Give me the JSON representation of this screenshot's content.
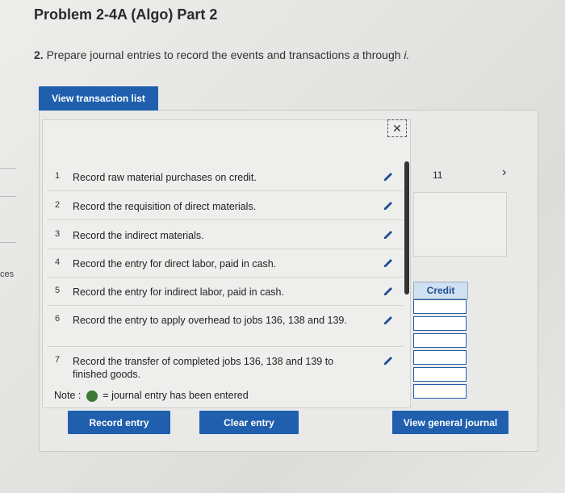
{
  "header": {
    "title": "Problem 2-4A (Algo) Part 2",
    "prompt_num": "2.",
    "prompt_text": "Prepare journal entries to record the events and transactions",
    "prompt_italic": "a",
    "prompt_through": "through",
    "prompt_end": "i."
  },
  "view_list_label": "View transaction list",
  "left_cut_text": "ces",
  "close_glyph": "✕",
  "transactions": [
    {
      "num": "1",
      "text": "Record raw material purchases on credit."
    },
    {
      "num": "2",
      "text": "Record the requisition of direct materials."
    },
    {
      "num": "3",
      "text": "Record the indirect materials."
    },
    {
      "num": "4",
      "text": "Record the entry for direct labor, paid in cash."
    },
    {
      "num": "5",
      "text": "Record the entry for indirect labor, paid in cash."
    },
    {
      "num": "6",
      "text": "Record the entry to apply overhead to jobs 136, 138 and 139."
    },
    {
      "num": "7",
      "text": "Record the transfer of completed jobs 136, 138 and 139 to finished goods."
    }
  ],
  "note": {
    "label": "Note :",
    "text": "= journal entry has been entered"
  },
  "right": {
    "page_number": "11",
    "chevron": "›",
    "credit_header": "Credit"
  },
  "buttons": {
    "record": "Record entry",
    "clear": "Clear entry",
    "view_gj": "View general journal"
  },
  "colors": {
    "button_blue": "#1f5fae",
    "entered_dot": "#3d7a33"
  }
}
